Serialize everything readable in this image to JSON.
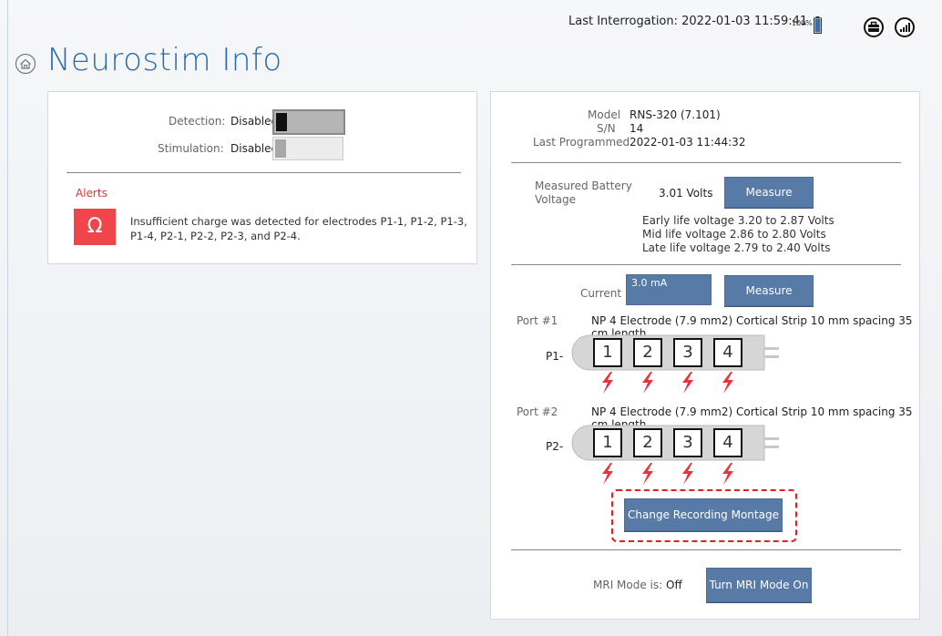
{
  "header": {
    "last_interrogation": "Last Interrogation: 2022-01-03 11:59:41",
    "battery_percent": "100%",
    "icons": [
      "battery-icon",
      "briefcase-icon",
      "signal-icon"
    ]
  },
  "page": {
    "title": "Neurostim Info",
    "title_icon": "home-icon"
  },
  "status": {
    "detection_label": "Detection:",
    "detection_value": "Disabled",
    "stimulation_label": "Stimulation:",
    "stimulation_value": "Disabled"
  },
  "alerts": {
    "title": "Alerts",
    "badge_symbol": "Ω",
    "message": "Insufficient charge was detected for electrodes P1-1, P1-2, P1-3, P1-4, P2-1, P2-2, P2-3, and P2-4."
  },
  "device": {
    "model_label": "Model",
    "model_value": "RNS-320 (7.101)",
    "sn_label": "S/N",
    "sn_value": "14",
    "last_programmed_label": "Last Programmed",
    "last_programmed_value": "2022-01-03 11:44:32"
  },
  "battery": {
    "label": "Measured Battery Voltage",
    "value": "3.01 Volts",
    "measure_button": "Measure",
    "early": "Early life voltage 3.20 to 2.87 Volts",
    "mid": "Mid life voltage 2.86 to 2.80 Volts",
    "late": "Late life voltage 2.79 to 2.40 Volts"
  },
  "current": {
    "label": "Current",
    "value": "3.0 mA",
    "measure_button": "Measure"
  },
  "ports": [
    {
      "label": "Port #1",
      "description": "NP 4 Electrode (7.9 mm2) Cortical Strip 10 mm spacing 35 cm length",
      "lead_prefix": "P1-",
      "electrodes": [
        "1",
        "2",
        "3",
        "4"
      ]
    },
    {
      "label": "Port #2",
      "description": "NP 4 Electrode (7.9 mm2) Cortical Strip 10 mm spacing 35 cm length",
      "lead_prefix": "P2-",
      "electrodes": [
        "1",
        "2",
        "3",
        "4"
      ]
    }
  ],
  "montage": {
    "button": "Change Recording Montage"
  },
  "mri": {
    "label": "MRI Mode is:",
    "value": "Off",
    "button": "Turn MRI Mode On"
  },
  "colors": {
    "accent": "#2a6bb1",
    "button": "#587aa6",
    "alert": "#f0464b",
    "bolt": "#e8353a",
    "highlight": "#e02020"
  }
}
